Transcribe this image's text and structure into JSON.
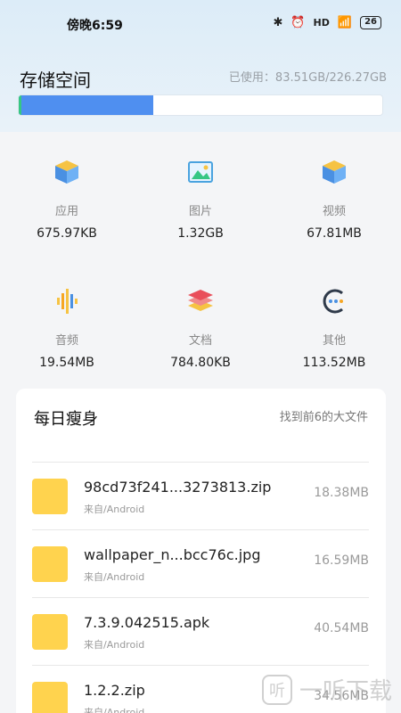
{
  "status_bar": {
    "time": "傍晚6:59",
    "battery": "26",
    "icons": [
      "bluetooth-icon",
      "alarm-icon",
      "hd-signal-icon",
      "wifi-icon",
      "battery-icon"
    ]
  },
  "header": {
    "title": "存储空间",
    "usage": "已使用：83.51GB/226.27GB",
    "usage_fraction": 0.369
  },
  "categories": [
    {
      "label": "应用",
      "size": "675.97KB",
      "icon": "app-box-icon"
    },
    {
      "label": "图片",
      "size": "1.32GB",
      "icon": "image-icon"
    },
    {
      "label": "视频",
      "size": "67.81MB",
      "icon": "video-box-icon"
    },
    {
      "label": "音频",
      "size": "19.54MB",
      "icon": "audio-wave-icon"
    },
    {
      "label": "文档",
      "size": "784.80KB",
      "icon": "document-stack-icon"
    },
    {
      "label": "其他",
      "size": "113.52MB",
      "icon": "more-circle-icon"
    }
  ],
  "card": {
    "title": "每日瘦身",
    "subtitle": "找到前6的大文件",
    "files": [
      {
        "name": "98cd73f241...3273813.zip",
        "source": "来自/Android",
        "size": "18.38MB"
      },
      {
        "name": "wallpaper_n...bcc76c.jpg",
        "source": "来自/Android",
        "size": "16.59MB"
      },
      {
        "name": "7.3.9.042515.apk",
        "source": "来自/Android",
        "size": "40.54MB"
      },
      {
        "name": "1.2.2.zip",
        "source": "来自/Android",
        "size": "34.56MB"
      }
    ]
  },
  "watermark": "一听下载",
  "colors": {
    "accent_blue": "#4f8ff0",
    "bar_edge_green": "#36c784",
    "folder_yellow": "#ffd34e"
  }
}
